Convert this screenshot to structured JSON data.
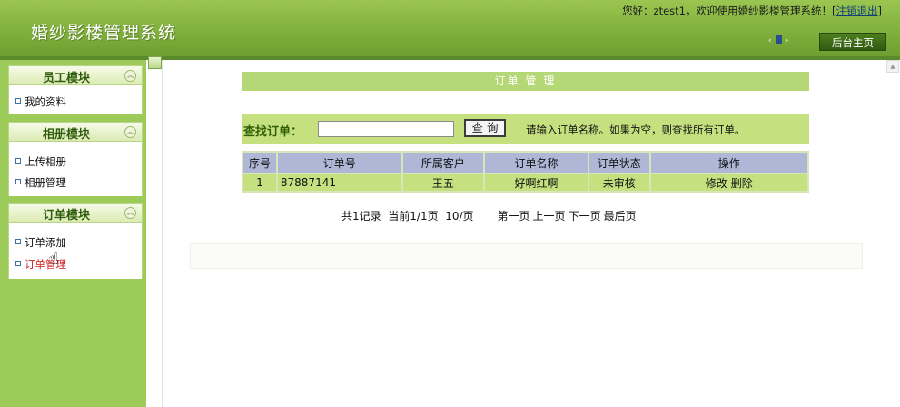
{
  "header": {
    "title": "婚纱影楼管理系统",
    "welcome_prefix": "您好：ztest1，欢迎使用婚纱影楼管理系统！[",
    "logout_label": "注销退出",
    "welcome_suffix": "]",
    "nav_left": "‹",
    "nav_right": "›",
    "home_label": "后台主页"
  },
  "sidebar": {
    "modules": [
      {
        "title": "员工模块",
        "items": [
          "我的资料"
        ]
      },
      {
        "title": "相册模块",
        "items": [
          "上传相册",
          "相册管理"
        ]
      },
      {
        "title": "订单模块",
        "items": [
          "订单添加",
          "订单管理"
        ]
      }
    ],
    "active_item": "订单管理"
  },
  "main": {
    "title": "订单 管 理",
    "search": {
      "label": "查找订单：",
      "value": "",
      "placeholder": "",
      "button_label": "查 询",
      "hint": "请输入订单名称。如果为空，则查找所有订单。"
    },
    "table": {
      "columns": [
        "序号",
        "订单号",
        "所属客户",
        "订单名称",
        "订单状态",
        "操作"
      ],
      "rows": [
        {
          "index": "1",
          "order_no": "87887141",
          "customer": "王五",
          "order_name": "好啊红啊",
          "status": "未审核",
          "actions": [
            "修改",
            "删除"
          ]
        }
      ]
    },
    "pager": {
      "summary": "共1记录  当前1/1页  10/页",
      "first": "第一页",
      "prev": "上一页",
      "next": "下一页",
      "last": "最后页"
    }
  },
  "colors": {
    "header_green": "#7fae3c",
    "sidebar_green": "#9ccb5a",
    "panel_green": "#c5e07f",
    "title_green": "#b5d876",
    "table_header": "#aeb8d6",
    "active_red": "#cc1f1f"
  }
}
